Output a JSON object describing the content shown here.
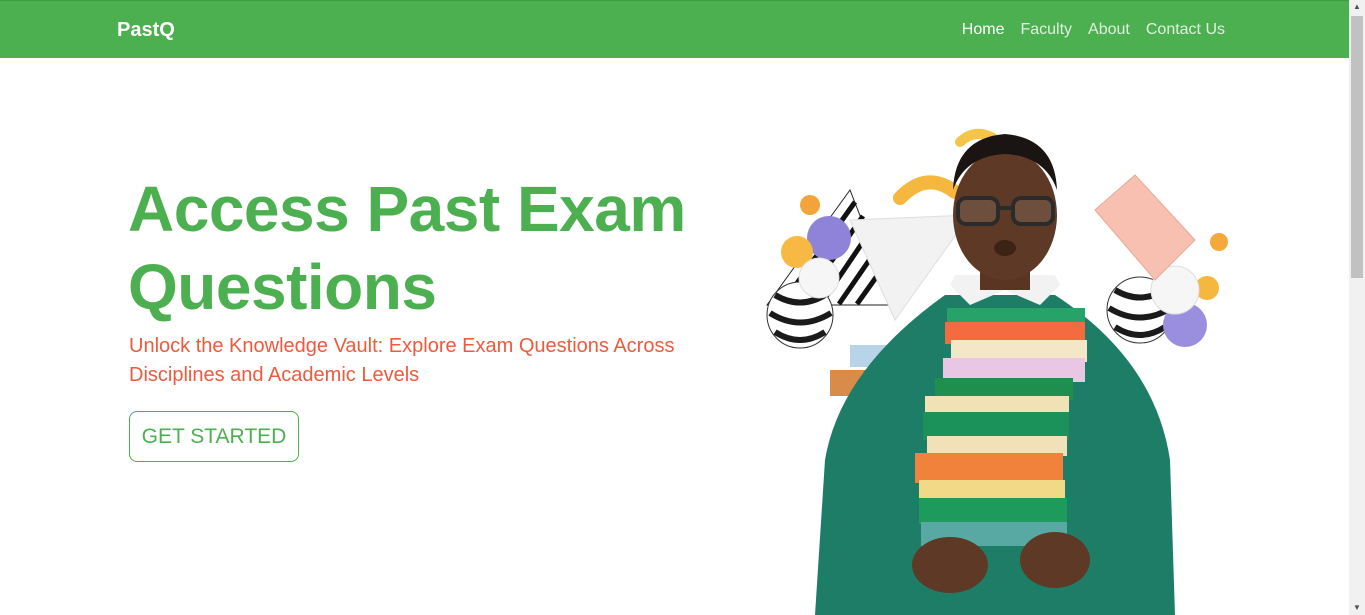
{
  "navbar": {
    "brand": "PastQ",
    "links": [
      {
        "label": "Home",
        "active": true
      },
      {
        "label": "Faculty",
        "active": false
      },
      {
        "label": "About",
        "active": false
      },
      {
        "label": "Contact Us",
        "active": false
      }
    ]
  },
  "hero": {
    "title": "Access Past Exam Questions",
    "subtitle": "Unlock the Knowledge Vault: Explore Exam Questions Across Disciplines and Academic Levels",
    "cta_label": "GET STARTED"
  },
  "colors": {
    "brand_green": "#4caf50",
    "subtitle_orange": "#ef5a3c"
  },
  "icons": {
    "scroll_up": "scroll-up-arrow-icon",
    "scroll_down": "scroll-down-arrow-icon"
  }
}
